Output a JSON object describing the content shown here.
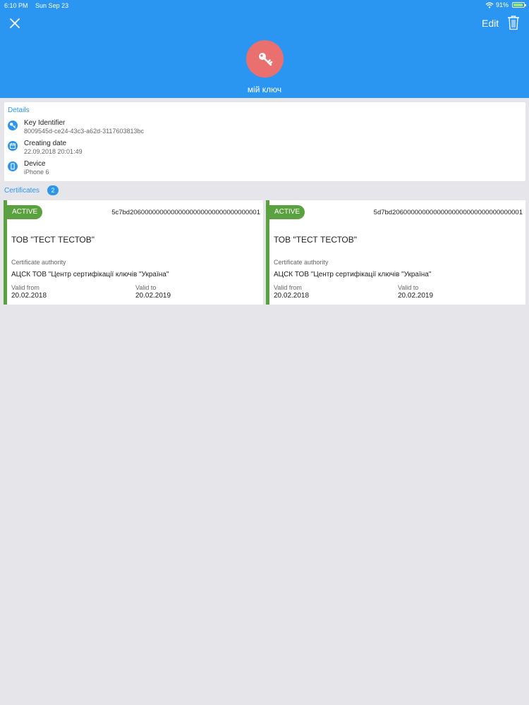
{
  "status_bar": {
    "time": "6:10 PM",
    "date": "Sun Sep 23",
    "battery_percent": "91%",
    "battery_level": 0.91
  },
  "header": {
    "edit_label": "Edit",
    "key_name": "мій ключ",
    "avatar_color": "#e9706f",
    "icons": {
      "close": "close-icon",
      "trash": "trash-icon",
      "key": "key-icon"
    }
  },
  "details": {
    "title": "Details",
    "items": [
      {
        "label": "Key Identifier",
        "value": "8009545d-ce24-43c3-a62d-3117603813bc",
        "icon": "key-icon"
      },
      {
        "label": "Creating date",
        "value": "22.09.2018 20:01:49",
        "icon": "calendar-icon"
      },
      {
        "label": "Device",
        "value": "iPhone 6",
        "icon": "phone-icon"
      }
    ]
  },
  "certificates": {
    "title": "Certificates",
    "count": "2",
    "items": [
      {
        "status": "ACTIVE",
        "serial": "5c7bd20600000000000000000000000000000001",
        "owner": "ТОВ \"ТЕСТ ТЕСТОВ\"",
        "ca_label": "Certificate authority",
        "ca_value": "АЦСК ТОВ \"Центр сертифікації ключів \"Україна\"",
        "valid_from_label": "Valid from",
        "valid_from": "20.02.2018",
        "valid_to_label": "Valid to",
        "valid_to": "20.02.2019"
      },
      {
        "status": "ACTIVE",
        "serial": "5d7bd20600000000000000000000000000000001",
        "owner": "ТОВ \"ТЕСТ ТЕСТОВ\"",
        "ca_label": "Certificate authority",
        "ca_value": "АЦСК ТОВ \"Центр сертифікації ключів \"Україна\"",
        "valid_from_label": "Valid from",
        "valid_from": "20.02.2018",
        "valid_to_label": "Valid to",
        "valid_to": "20.02.2019"
      }
    ]
  },
  "colors": {
    "header": "#2b96f1",
    "accent": "#2b96f1",
    "active": "#5aa13f",
    "background": "#e6e6ea"
  }
}
